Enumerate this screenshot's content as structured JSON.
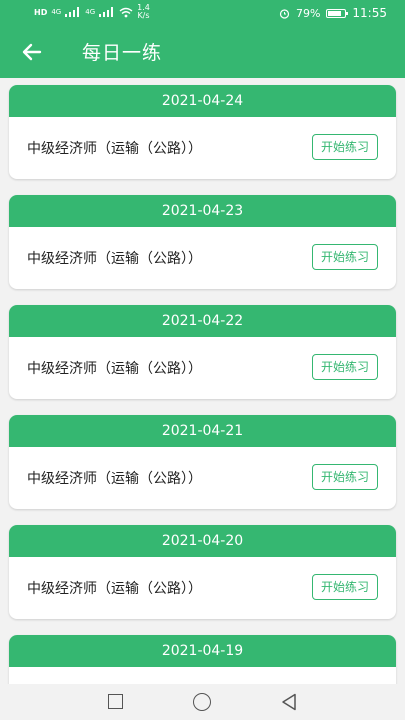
{
  "status": {
    "net_left": "HD",
    "signal_label_1": "4G",
    "signal_label_2": "4G",
    "speed_value": "1.4",
    "speed_unit": "K/s",
    "battery": "79%",
    "battery_level": 0.79,
    "time": "11:55"
  },
  "appbar": {
    "title": "每日一练"
  },
  "cards": [
    {
      "date": "2021-04-24",
      "name": "中级经济师（运输（公路））",
      "button": "开始练习"
    },
    {
      "date": "2021-04-23",
      "name": "中级经济师（运输（公路））",
      "button": "开始练习"
    },
    {
      "date": "2021-04-22",
      "name": "中级经济师（运输（公路））",
      "button": "开始练习"
    },
    {
      "date": "2021-04-21",
      "name": "中级经济师（运输（公路））",
      "button": "开始练习"
    },
    {
      "date": "2021-04-20",
      "name": "中级经济师（运输（公路））",
      "button": "开始练习"
    },
    {
      "date": "2021-04-19"
    }
  ],
  "colors": {
    "primary": "#35b771",
    "background": "#f2f2f2"
  }
}
